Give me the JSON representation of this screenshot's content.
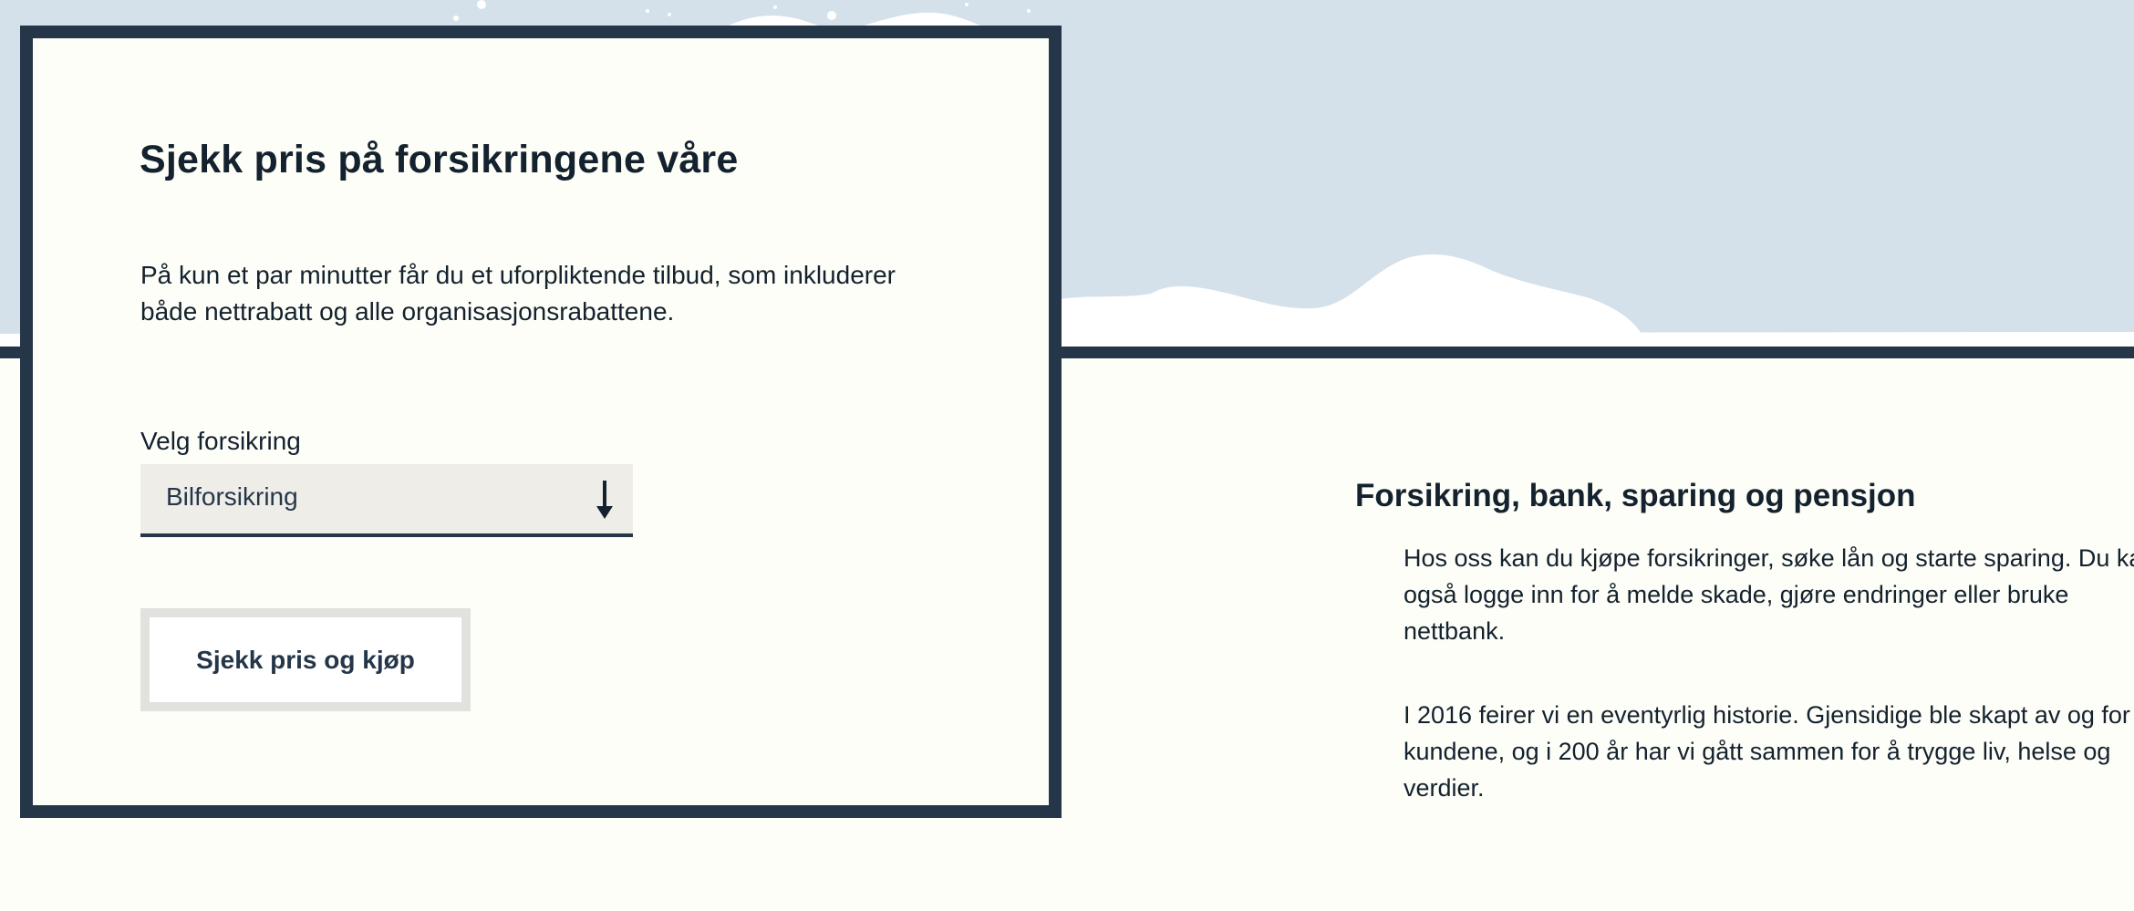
{
  "quote_card": {
    "title": "Sjekk pris på forsikringene våre",
    "intro": "På kun et par minutter får du et uforpliktende tilbud, som inkluderer både nettrabatt og alle organisasjonsrabattene.",
    "select_label": "Velg forsikring",
    "select_value": "Bilforsikring",
    "select_icon": "arrow-down-icon",
    "cta_label": "Sjekk pris og kjøp"
  },
  "info": {
    "title": "Forsikring, bank, sparing og pensjon",
    "paragraph_1": "Hos oss kan du kjøpe forsikringer, søke lån og starte sparing. Du kan også logge inn for å melde skade, gjøre endringer eller bruke nettbank.",
    "paragraph_2": "I 2016 feirer vi en eventyrlig historie. Gjensidige ble skapt av og for kundene, og i 200 år har vi gått sammen for å trygge liv, helse og verdier."
  },
  "colors": {
    "navy": "#253649",
    "sky": "#d4e1ea",
    "cream": "#fdfef7",
    "select_bg": "#efede8",
    "button_border": "#e1e1dd"
  }
}
